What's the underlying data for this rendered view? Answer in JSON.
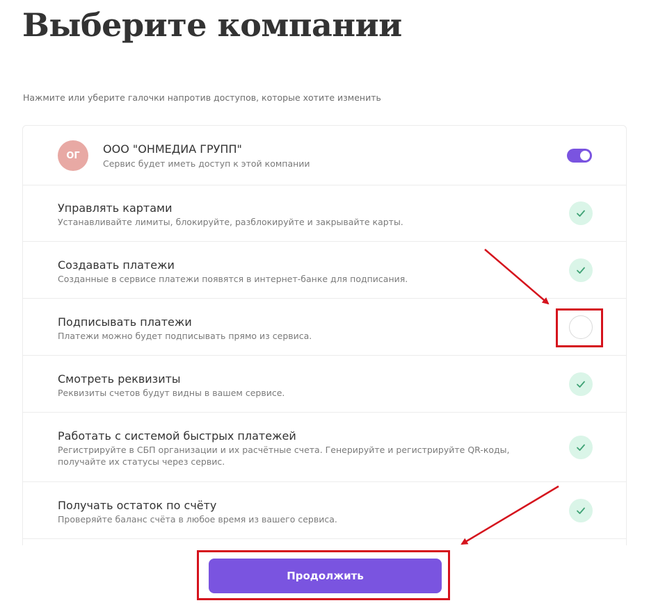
{
  "page": {
    "title": "Выберите компании",
    "subtitle": "Нажмите или уберите галочки напротив доступов, которые хотите изменить"
  },
  "company": {
    "avatar_initials": "ОГ",
    "name": "ООО \"ОНМЕДИА ГРУПП\"",
    "description": "Сервис будет иметь доступ к этой компании",
    "toggle_on": true
  },
  "permissions": [
    {
      "title": "Управлять картами",
      "description": "Устанавливайте лимиты, блокируйте, разблокируйте и закрывайте карты.",
      "checked": true
    },
    {
      "title": "Создавать платежи",
      "description": "Созданные в сервисе платежи появятся в интернет-банке для подписания.",
      "checked": true
    },
    {
      "title": "Подписывать платежи",
      "description": "Платежи можно будет подписывать прямо из сервиса.",
      "checked": false
    },
    {
      "title": "Смотреть реквизиты",
      "description": "Реквизиты счетов будут видны в вашем сервисе.",
      "checked": true
    },
    {
      "title": "Работать с системой быстрых платежей",
      "description": "Регистрируйте в СБП организации и их расчётные счета. Генерируйте и регистрируйте QR-коды, получайте их статусы через сервис.",
      "checked": true
    },
    {
      "title": "Получать остаток по счёту",
      "description": "Проверяйте баланс счёта в любое время из вашего сервиса.",
      "checked": true
    }
  ],
  "actions": {
    "continue_label": "Продолжить"
  },
  "colors": {
    "accent": "#7a54e0",
    "check_bg": "#daf5e8",
    "check_mark": "#3fa275",
    "annotation": "#d5131d",
    "avatar": "#e8a9a4"
  },
  "icons": {
    "check": "checkmark-icon",
    "arrow": "annotation-arrow"
  }
}
